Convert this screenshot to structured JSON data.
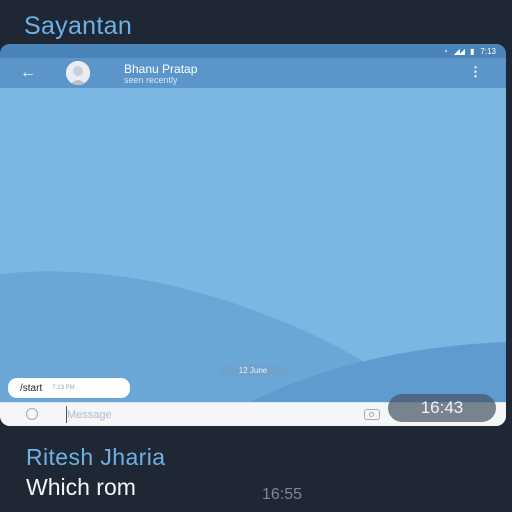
{
  "outer_chat": {
    "top_sender": "Sayantan",
    "bottom_sender": "Ritesh Jharia",
    "bottom_message": "Which rom",
    "bottom_time": "16:55",
    "overlay_time": "16:43"
  },
  "screenshot": {
    "status_bar": {
      "time": "7:13",
      "icons": [
        "wifi-icon",
        "signal-icon",
        "battery-icon"
      ]
    },
    "header": {
      "contact_name": "Bhanu Pratap",
      "status": "seen recently",
      "back_icon": "arrow-left-icon",
      "menu_icon": "vertical-dots-icon"
    },
    "chat": {
      "date_label": "12 June",
      "message": {
        "text": "/start",
        "time": "7:13 PM"
      }
    },
    "composer": {
      "placeholder": "Message",
      "emoji_icon": "smile-icon",
      "attach_icon": "camera-icon"
    },
    "colors": {
      "header": "#5b95c9",
      "chat_background": "#7cb7e4",
      "accent": "#6cb2e6"
    }
  }
}
